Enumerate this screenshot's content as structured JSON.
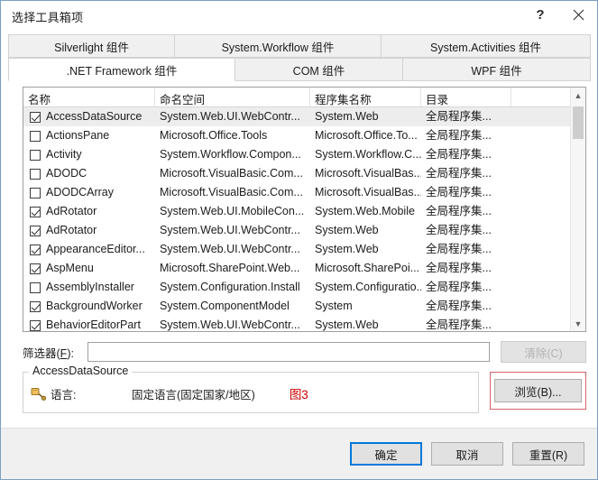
{
  "window": {
    "title": "选择工具箱项",
    "help_icon": "help-question-icon",
    "close_icon": "close-icon"
  },
  "tabs": {
    "row1": [
      {
        "label": "Silverlight 组件",
        "selected": false
      },
      {
        "label": "System.Workflow 组件",
        "selected": false
      },
      {
        "label": "System.Activities 组件",
        "selected": false
      }
    ],
    "row2": [
      {
        "label": ".NET Framework 组件",
        "selected": true
      },
      {
        "label": "COM 组件",
        "selected": false
      },
      {
        "label": "WPF 组件",
        "selected": false
      }
    ]
  },
  "list": {
    "columns": [
      "名称",
      "命名空间",
      "程序集名称",
      "目录",
      ""
    ],
    "rows": [
      {
        "checked": true,
        "selected": true,
        "name": "AccessDataSource",
        "namespace": "System.Web.UI.WebContr...",
        "assembly": "System.Web",
        "directory": "全局程序集..."
      },
      {
        "checked": false,
        "selected": false,
        "name": "ActionsPane",
        "namespace": "Microsoft.Office.Tools",
        "assembly": "Microsoft.Office.To...",
        "directory": "全局程序集..."
      },
      {
        "checked": false,
        "selected": false,
        "name": "Activity",
        "namespace": "System.Workflow.Compon...",
        "assembly": "System.Workflow.C...",
        "directory": "全局程序集..."
      },
      {
        "checked": false,
        "selected": false,
        "name": "ADODC",
        "namespace": "Microsoft.VisualBasic.Com...",
        "assembly": "Microsoft.VisualBas...",
        "directory": "全局程序集..."
      },
      {
        "checked": false,
        "selected": false,
        "name": "ADODCArray",
        "namespace": "Microsoft.VisualBasic.Com...",
        "assembly": "Microsoft.VisualBas...",
        "directory": "全局程序集..."
      },
      {
        "checked": true,
        "selected": false,
        "name": "AdRotator",
        "namespace": "System.Web.UI.MobileCon...",
        "assembly": "System.Web.Mobile",
        "directory": "全局程序集..."
      },
      {
        "checked": true,
        "selected": false,
        "name": "AdRotator",
        "namespace": "System.Web.UI.WebContr...",
        "assembly": "System.Web",
        "directory": "全局程序集..."
      },
      {
        "checked": true,
        "selected": false,
        "name": "AppearanceEditor...",
        "namespace": "System.Web.UI.WebContr...",
        "assembly": "System.Web",
        "directory": "全局程序集..."
      },
      {
        "checked": true,
        "selected": false,
        "name": "AspMenu",
        "namespace": "Microsoft.SharePoint.Web...",
        "assembly": "Microsoft.SharePoi...",
        "directory": "全局程序集..."
      },
      {
        "checked": false,
        "selected": false,
        "name": "AssemblyInstaller",
        "namespace": "System.Configuration.Install",
        "assembly": "System.Configuratio...",
        "directory": "全局程序集..."
      },
      {
        "checked": true,
        "selected": false,
        "name": "BackgroundWorker",
        "namespace": "System.ComponentModel",
        "assembly": "System",
        "directory": "全局程序集..."
      },
      {
        "checked": true,
        "selected": false,
        "name": "BehaviorEditorPart",
        "namespace": "System.Web.UI.WebContr...",
        "assembly": "System.Web",
        "directory": "全局程序集..."
      }
    ],
    "scrollbar": {
      "up_icon": "chevron-up-icon",
      "down_icon": "chevron-down-icon"
    }
  },
  "filter": {
    "label": "筛选器(F):",
    "label_prefix": "筛选器(",
    "label_accel": "F",
    "label_suffix": "):",
    "value": "",
    "placeholder": "",
    "clear_button": "清除(C)",
    "clear_disabled": true
  },
  "details": {
    "group_title": "AccessDataSource",
    "icon": "property-language-icon",
    "property_label": "语言:",
    "property_value": "固定语言(固定国家/地区)",
    "annotation": "图3",
    "annotation_color": "#cc0000",
    "browse_button": "浏览(B)...",
    "highlight_color": "#d4636c"
  },
  "footer": {
    "ok": "确定",
    "cancel": "取消",
    "reset": "重置(R)",
    "default_border_color": "#0078d7"
  }
}
